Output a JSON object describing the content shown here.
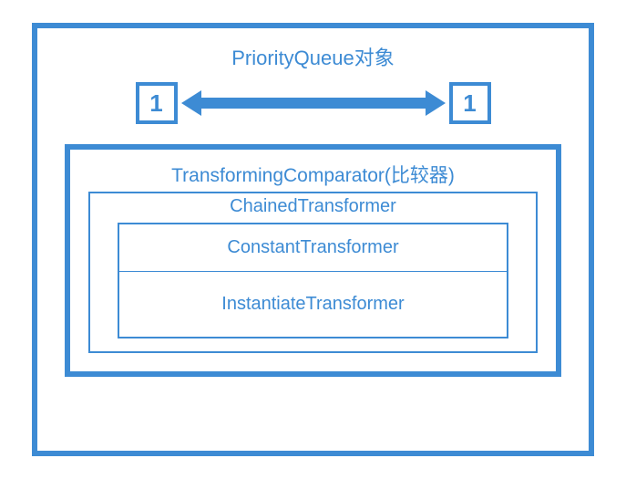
{
  "outer": {
    "title": "PriorityQueue对象",
    "left_value": "1",
    "right_value": "1"
  },
  "comparator": {
    "title": "TransformingComparator(比较器)",
    "chained": {
      "title": "ChainedTransformer",
      "items": [
        "ConstantTransformer",
        "InstantiateTransformer"
      ]
    }
  }
}
